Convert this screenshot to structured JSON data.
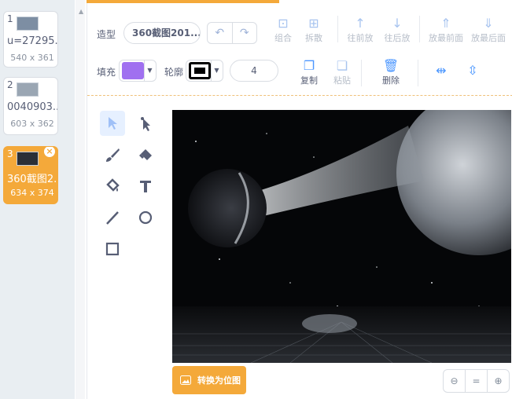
{
  "costumes": [
    {
      "index": "1",
      "name": "u=27295...",
      "size": "540 x 361"
    },
    {
      "index": "2",
      "name": "0040903...",
      "size": "603 x 362"
    },
    {
      "index": "3",
      "name": "360截图2...",
      "size": "634 x 374"
    }
  ],
  "toolbar": {
    "costume_label": "造型",
    "costume_name": "360截图201...",
    "group": "组合",
    "ungroup": "拆散",
    "forward": "往前放",
    "backward": "往后放",
    "front": "放最前面",
    "back": "放最后面",
    "fill_label": "填充",
    "outline_label": "轮廓",
    "outline_width": "4",
    "copy": "复制",
    "paste": "粘贴",
    "delete": "删除"
  },
  "colors": {
    "fill": "#a070f0",
    "outline": "#000000",
    "accent": "#f4a93a"
  },
  "bottom": {
    "convert_label": "转换为位图"
  }
}
